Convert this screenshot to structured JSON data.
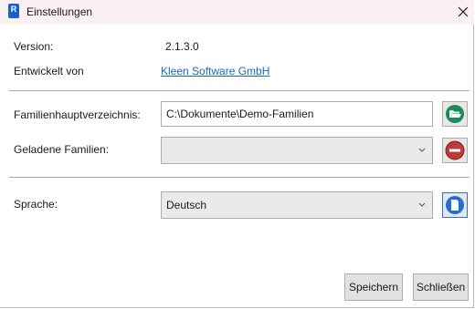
{
  "window": {
    "title": "Einstellungen"
  },
  "info": {
    "version_label": "Version:",
    "version_value": "2.1.3.0",
    "developer_label": "Entwickelt von",
    "developer_link": "Kleen Software GmbH"
  },
  "settings": {
    "family_dir_label": "Familienhauptverzeichnis:",
    "family_dir_value": "C:\\Dokumente\\Demo-Familien",
    "loaded_families_label": "Geladene Familien:",
    "loaded_families_value": "",
    "language_label": "Sprache:",
    "language_value": "Deutsch"
  },
  "icons": {
    "app": "revit-app-icon",
    "close": "close-icon",
    "browse": "folder-open-icon",
    "remove": "remove-icon",
    "language": "document-icon"
  },
  "buttons": {
    "save": "Speichern",
    "close": "Schließen"
  }
}
